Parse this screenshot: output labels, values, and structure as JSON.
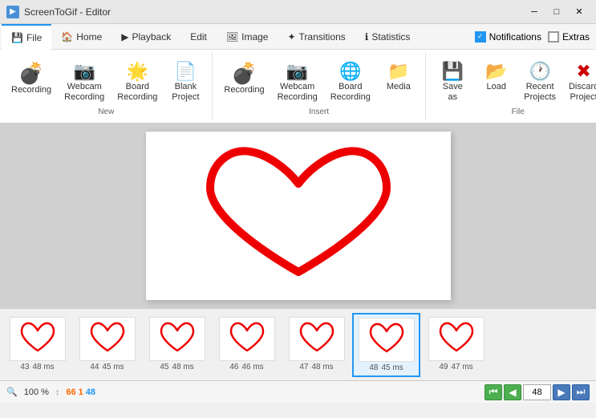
{
  "titlebar": {
    "app_name": "ScreenToGif - Editor",
    "icon": "🎬"
  },
  "ribbon": {
    "tabs": [
      {
        "id": "file",
        "label": "File",
        "icon": "💾",
        "active": true
      },
      {
        "id": "home",
        "label": "Home",
        "icon": "🏠",
        "active": false
      },
      {
        "id": "playback",
        "label": "Playback",
        "icon": "▶",
        "active": false
      },
      {
        "id": "edit",
        "label": "Edit",
        "icon": "",
        "active": false
      },
      {
        "id": "image",
        "label": "Image",
        "icon": "🖼",
        "active": false
      },
      {
        "id": "transitions",
        "label": "Transitions",
        "icon": "✦",
        "active": false
      },
      {
        "id": "statistics",
        "label": "Statistics",
        "icon": "ℹ",
        "active": false
      }
    ],
    "toggles": [
      {
        "id": "notifications",
        "label": "Notifications",
        "checked": true
      },
      {
        "id": "extras",
        "label": "Extras",
        "checked": false
      }
    ],
    "groups": {
      "new": {
        "label": "New",
        "buttons": [
          {
            "id": "recording",
            "icon": "💣",
            "label": "Recording",
            "multiline": false
          },
          {
            "id": "webcam-recording",
            "icon": "📷",
            "label": "Webcam\nRecording",
            "multiline": true
          },
          {
            "id": "board-recording",
            "icon": "🌟",
            "label": "Board\nRecording",
            "multiline": true
          },
          {
            "id": "blank-project",
            "icon": "📄",
            "label": "Blank\nProject",
            "multiline": true
          }
        ]
      },
      "insert": {
        "label": "Insert",
        "buttons": [
          {
            "id": "recording2",
            "icon": "💣",
            "label": "Recording",
            "multiline": false
          },
          {
            "id": "webcam-recording2",
            "icon": "📷",
            "label": "Webcam\nRecording",
            "multiline": true
          },
          {
            "id": "board-recording2",
            "icon": "🌐",
            "label": "Board\nRecording",
            "multiline": true
          },
          {
            "id": "media",
            "icon": "📁",
            "label": "Media",
            "multiline": false
          }
        ]
      },
      "file": {
        "label": "File",
        "buttons": [
          {
            "id": "save-as",
            "icon": "💾",
            "label": "Save as",
            "multiline": false
          },
          {
            "id": "load",
            "icon": "📂",
            "label": "Load",
            "multiline": false
          },
          {
            "id": "recent-projects",
            "icon": "🕐",
            "label": "Recent\nProjects",
            "multiline": true
          },
          {
            "id": "discard-project",
            "icon": "✖",
            "label": "Discard\nProject",
            "multiline": true
          }
        ]
      }
    }
  },
  "frames": [
    {
      "num": 43,
      "ms": 48,
      "selected": false
    },
    {
      "num": 44,
      "ms": 45,
      "selected": false
    },
    {
      "num": 45,
      "ms": 48,
      "selected": false
    },
    {
      "num": 46,
      "ms": 46,
      "selected": false
    },
    {
      "num": 47,
      "ms": 48,
      "selected": false
    },
    {
      "num": 48,
      "ms": 45,
      "selected": true
    },
    {
      "num": 49,
      "ms": 47,
      "selected": false
    }
  ],
  "statusbar": {
    "zoom_label": "100",
    "zoom_percent": "%",
    "frame_count": "66",
    "frame_current": "1",
    "frame_max": "48",
    "search_icon": "🔍",
    "arrows": {
      "back_start": "⏮",
      "back": "◀",
      "forward": "▶",
      "forward_end": "⏭"
    }
  }
}
